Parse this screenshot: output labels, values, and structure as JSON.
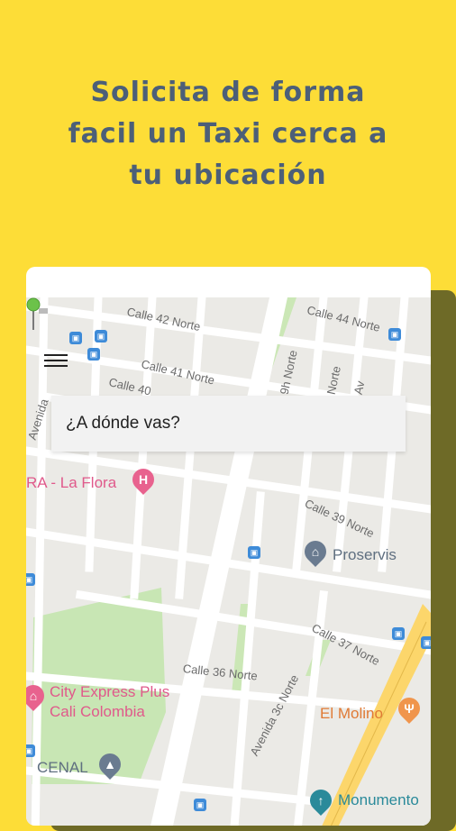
{
  "headline": {
    "line1": "Solicita de forma",
    "line2": "facil un Taxi cerca a",
    "line3": "tu ubicación"
  },
  "app": {
    "search_placeholder": "¿A dónde vas?"
  },
  "map": {
    "streets": [
      "Calle 42 Norte",
      "Calle 44 Norte",
      "Calle 41 Norte",
      "Calle 40",
      "Calle 39 Norte",
      "Calle 37 Norte",
      "Calle 36 Norte",
      "Avenida 3c Norte",
      "Avenida",
      "9h Norte",
      "Norte",
      "Av"
    ],
    "places": [
      "RA - La Flora",
      "Proservis",
      "City Express Plus",
      "Cali Colombia",
      "El Molino",
      "CENAL",
      "Monumento"
    ]
  },
  "colors": {
    "background": "#FDDD37",
    "headline": "#4C5F78",
    "park": "#C8E6B4",
    "avenue": "#FCD66B"
  }
}
